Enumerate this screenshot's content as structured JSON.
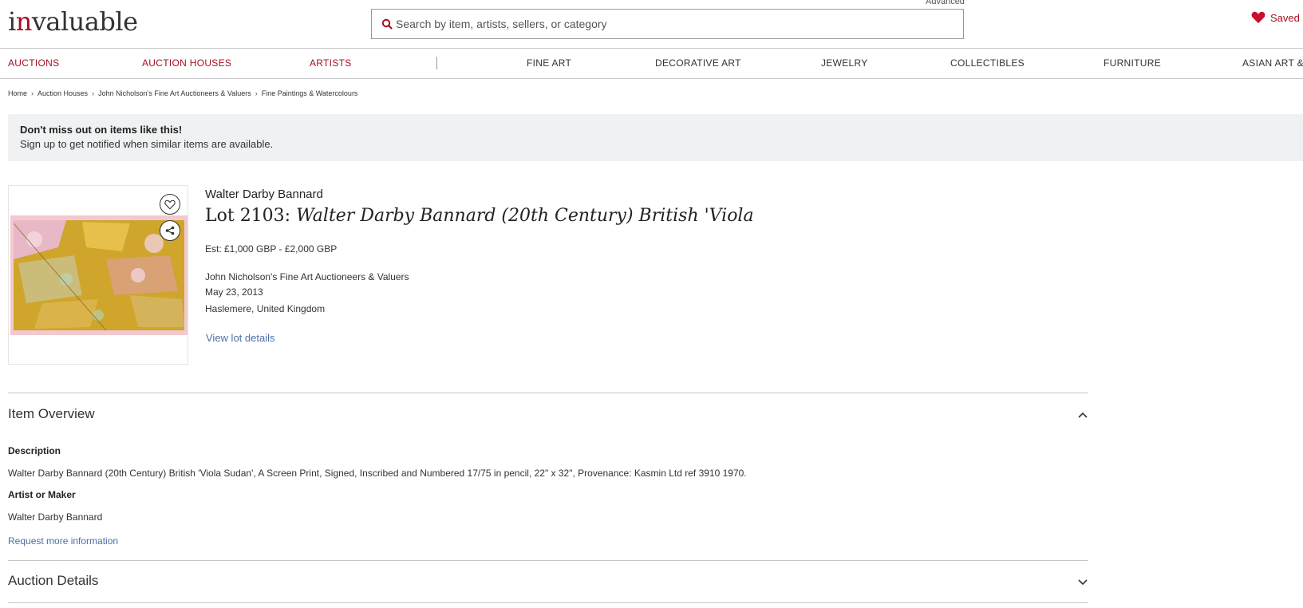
{
  "header": {
    "logo_text_pre": "i",
    "logo_text_red": "n",
    "logo_text_post": "valuable",
    "advanced_link": "Advanced",
    "search_placeholder": "Search by item, artists, sellers, or category",
    "saved_label": "Saved",
    "brand_color": "#a50f1f"
  },
  "nav": {
    "items": [
      {
        "label": "AUCTIONS"
      },
      {
        "label": "AUCTION HOUSES"
      },
      {
        "label": "ARTISTS"
      },
      {
        "label": "FINE ART"
      },
      {
        "label": "DECORATIVE ART"
      },
      {
        "label": "JEWELRY"
      },
      {
        "label": "COLLECTIBLES"
      },
      {
        "label": "FURNITURE"
      },
      {
        "label": "ASIAN ART &"
      }
    ]
  },
  "breadcrumb": [
    "Home",
    "Auction Houses",
    "John Nicholson's Fine Art Auctioneers & Valuers",
    "Fine Paintings & Watercolours"
  ],
  "banner": {
    "title": "Don't miss out on items like this!",
    "text": "Sign up to get notified when similar items are available."
  },
  "lot": {
    "artist": "Walter Darby Bannard",
    "lot_prefix": "Lot 2103: ",
    "lot_title": "Walter Darby Bannard (20th Century) British 'Viola",
    "estimate": "Est: £1,000 GBP - £2,000 GBP",
    "auction_house": "John Nicholson's Fine Art Auctioneers & Valuers",
    "date": "May 23, 2013",
    "location": "Haslemere, United Kingdom",
    "view_details": "View lot details"
  },
  "overview": {
    "title": "Item Overview",
    "description_heading": "Description",
    "description": "Walter Darby Bannard (20th Century) British 'Viola Sudan', A Screen Print, Signed, Inscribed and Numbered 17/75 in pencil, 22\" x 32\", Provenance: Kasmin Ltd ref 3910 1970.",
    "maker_heading": "Artist or Maker",
    "maker": "Walter Darby Bannard",
    "request_info": "Request more information"
  },
  "auction_details": {
    "title": "Auction Details"
  }
}
